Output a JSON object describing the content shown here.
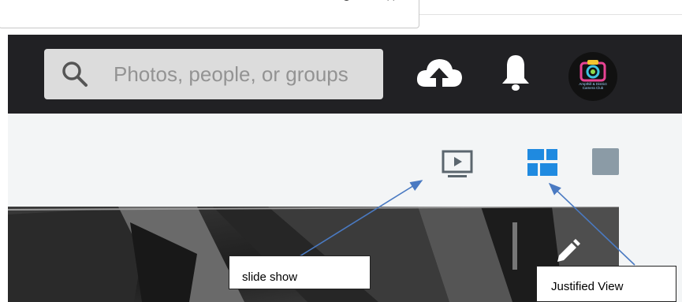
{
  "search": {
    "placeholder": "Photos, people, or groups"
  },
  "avatar": {
    "text": "Ampthill & District\nCamera Club"
  },
  "callouts": {
    "slideshow": "slide show",
    "justified": "Justified View"
  },
  "colors": {
    "header_bg": "#212124",
    "search_bg": "#dcdcdc",
    "toolbar_bg": "#f3f5f6",
    "justified_icon": "#1f8ae0",
    "slideshow_icon": "#5b666e",
    "single_icon": "#8b9ba6",
    "arrow": "#4a7ac2"
  },
  "icons": {
    "search": "search-icon",
    "upload": "cloud-upload-icon",
    "notifications": "bell-icon",
    "slideshow": "slideshow-icon",
    "justified": "justified-view-icon",
    "single": "single-view-icon",
    "edit": "pencil-icon"
  }
}
